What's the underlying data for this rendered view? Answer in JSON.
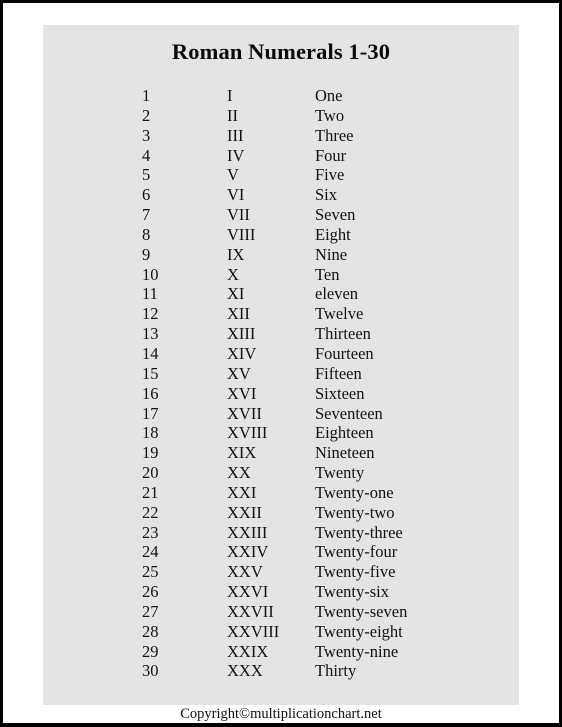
{
  "document": {
    "title": "Roman Numerals 1-30",
    "footer": "Copyright©multiplicationchart.net",
    "panel_color": "#e4e4e4",
    "border_color": "#000000",
    "text_color": "#111111"
  },
  "table": {
    "rows": [
      {
        "arabic": "1",
        "roman": "I",
        "word": "One"
      },
      {
        "arabic": "2",
        "roman": "II",
        "word": "Two"
      },
      {
        "arabic": "3",
        "roman": "III",
        "word": "Three"
      },
      {
        "arabic": "4",
        "roman": "IV",
        "word": "Four"
      },
      {
        "arabic": "5",
        "roman": "V",
        "word": "Five"
      },
      {
        "arabic": "6",
        "roman": "VI",
        "word": "Six"
      },
      {
        "arabic": "7",
        "roman": "VII",
        "word": "Seven"
      },
      {
        "arabic": "8",
        "roman": "VIII",
        "word": "Eight"
      },
      {
        "arabic": "9",
        "roman": "IX",
        "word": "Nine"
      },
      {
        "arabic": "10",
        "roman": "X",
        "word": "Ten"
      },
      {
        "arabic": "11",
        "roman": "XI",
        "word": "eleven"
      },
      {
        "arabic": "12",
        "roman": "XII",
        "word": "Twelve"
      },
      {
        "arabic": "13",
        "roman": "XIII",
        "word": "Thirteen"
      },
      {
        "arabic": "14",
        "roman": "XIV",
        "word": "Fourteen"
      },
      {
        "arabic": "15",
        "roman": "XV",
        "word": "Fifteen"
      },
      {
        "arabic": "16",
        "roman": "XVI",
        "word": "Sixteen"
      },
      {
        "arabic": "17",
        "roman": "XVII",
        "word": "Seventeen"
      },
      {
        "arabic": "18",
        "roman": "XVIII",
        "word": "Eighteen"
      },
      {
        "arabic": "19",
        "roman": "XIX",
        "word": "Nineteen"
      },
      {
        "arabic": "20",
        "roman": "XX",
        "word": "Twenty"
      },
      {
        "arabic": "21",
        "roman": "XXI",
        "word": "Twenty-one"
      },
      {
        "arabic": "22",
        "roman": "XXII",
        "word": "Twenty-two"
      },
      {
        "arabic": "23",
        "roman": "XXIII",
        "word": "Twenty-three"
      },
      {
        "arabic": "24",
        "roman": "XXIV",
        "word": "Twenty-four"
      },
      {
        "arabic": "25",
        "roman": "XXV",
        "word": "Twenty-five"
      },
      {
        "arabic": "26",
        "roman": "XXVI",
        "word": "Twenty-six"
      },
      {
        "arabic": "27",
        "roman": "XXVII",
        "word": "Twenty-seven"
      },
      {
        "arabic": "28",
        "roman": "XXVIII",
        "word": "Twenty-eight"
      },
      {
        "arabic": "29",
        "roman": "XXIX",
        "word": "Twenty-nine"
      },
      {
        "arabic": "30",
        "roman": "XXX",
        "word": "Thirty"
      }
    ]
  }
}
